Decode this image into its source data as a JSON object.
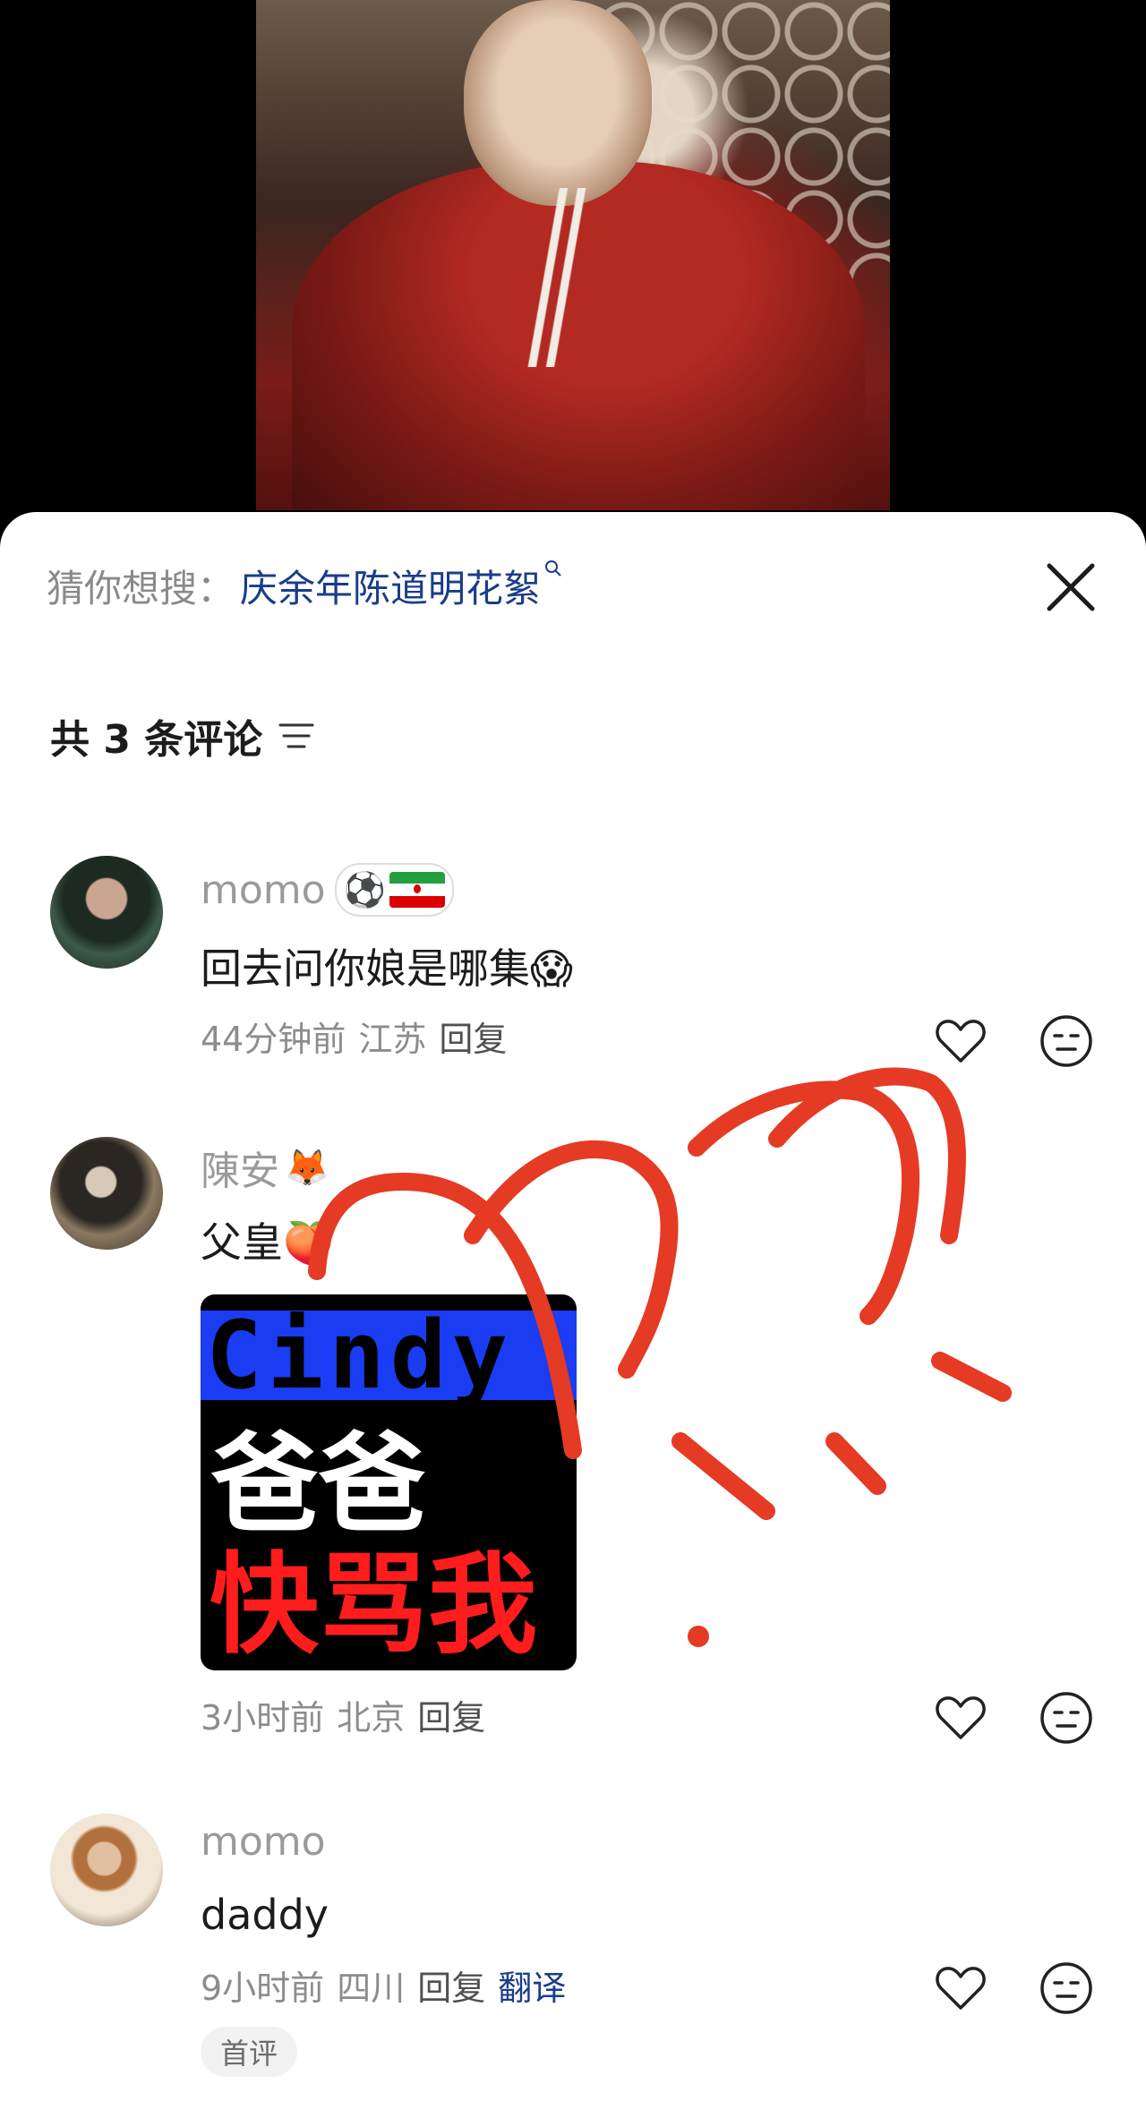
{
  "suggest": {
    "prefix": "猜你想搜：",
    "term": "庆余年陈道明花絮",
    "search_icon": "search-icon"
  },
  "comments_header": {
    "count_label": "共 3 条评论"
  },
  "comments": [
    {
      "username": "momo",
      "badges": [
        "⚽",
        "iran-flag"
      ],
      "text": "回去问你娘是哪集",
      "emoji": "😱",
      "time": "44分钟前",
      "location": "江苏",
      "reply": "回复"
    },
    {
      "username": "陳安",
      "badge_emoji": "🦊",
      "text": "父皇",
      "emoji": "🍑",
      "sticker": {
        "line1": "Cindy",
        "line2": "爸爸",
        "line3": "快骂我"
      },
      "time": "3小时前",
      "location": "北京",
      "reply": "回复"
    },
    {
      "username": "momo",
      "text": "daddy",
      "time": "9小时前",
      "location": "四川",
      "reply": "回复",
      "translate": "翻译",
      "tag": "首评"
    }
  ],
  "colors": {
    "accent": "#1a3d8a",
    "annotation": "#e53a24"
  }
}
